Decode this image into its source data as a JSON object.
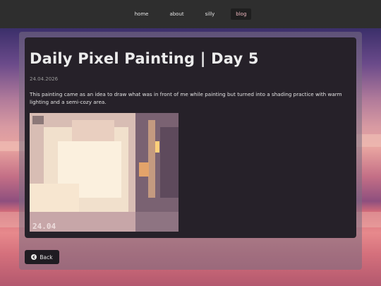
{
  "nav": {
    "items": [
      {
        "label": "home"
      },
      {
        "label": "about"
      },
      {
        "label": "silly"
      },
      {
        "label": "blog",
        "active": true
      }
    ]
  },
  "post": {
    "title": "Daily Pixel Painting | Day 5",
    "date": "24.04.2026",
    "description": "This painting came as an idea to draw what was in front of me while painting but turned into a shading practice with warm lighting and a semi-cozy area.",
    "artwork_caption": "24.04"
  },
  "back_button": {
    "label": "Back",
    "icon": "arrow-left-icon"
  },
  "colors": {
    "navbar": "#2e2e2e",
    "card": "#262129",
    "active_nav_text": "#f0b8c0"
  }
}
